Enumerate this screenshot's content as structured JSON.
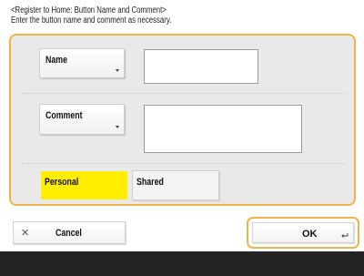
{
  "header": {
    "title": "<Register to Home: Button Name and Comment>",
    "instruction": "Enter the button name and comment as necessary."
  },
  "form": {
    "name_button_label": "Name",
    "name_value": "",
    "comment_button_label": "Comment",
    "comment_value": "",
    "tabs": [
      {
        "label": "Personal",
        "selected": true
      },
      {
        "label": "Shared",
        "selected": false
      }
    ]
  },
  "footer": {
    "cancel_label": "Cancel",
    "cancel_icon": "close-icon",
    "ok_label": "OK",
    "ok_icon": "enter-icon"
  },
  "colors": {
    "accent_border": "#f0b34a",
    "selected_tab": "#ffee00",
    "panel_background": "#e9e9e9",
    "footer_bar": "#242424"
  }
}
